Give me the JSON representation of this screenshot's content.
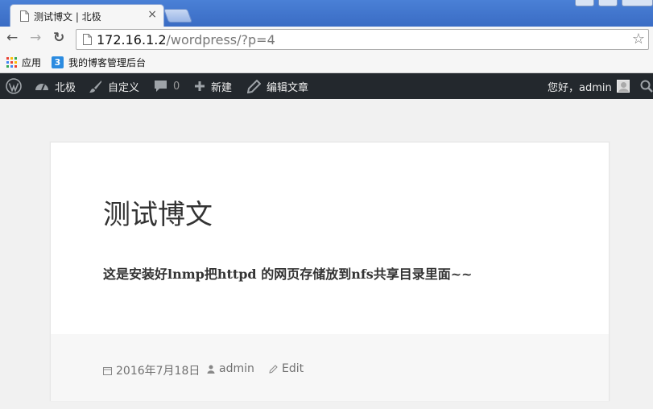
{
  "browser": {
    "tab_title": "测试博文 | 北极",
    "tab_close": "×",
    "url_host": "172.16.1.2",
    "url_path": "/wordpress/?p=4",
    "back_glyph": "←",
    "forward_glyph": "→",
    "reload_glyph": "↻",
    "star_glyph": "☆"
  },
  "bookmarks": {
    "apps_label": "应用",
    "blog_admin_label": "我的博客管理后台",
    "blog_admin_icon_text": "3"
  },
  "adminbar": {
    "site_name": "北极",
    "customize": "自定义",
    "comments_count": "0",
    "new": "新建",
    "edit_post": "编辑文章",
    "greeting": "您好，admin"
  },
  "post": {
    "title": "测试博文",
    "content": "这是安装好lnmp把httpd 的网页存储放到nfs共享目录里面~~",
    "date": "2016年7月18日",
    "author": "admin",
    "edit": "Edit"
  },
  "colors": {
    "adminbar_bg": "#23282d",
    "tabstrip_blue": "#3a6cc4",
    "page_bg": "#f1f1f1"
  }
}
